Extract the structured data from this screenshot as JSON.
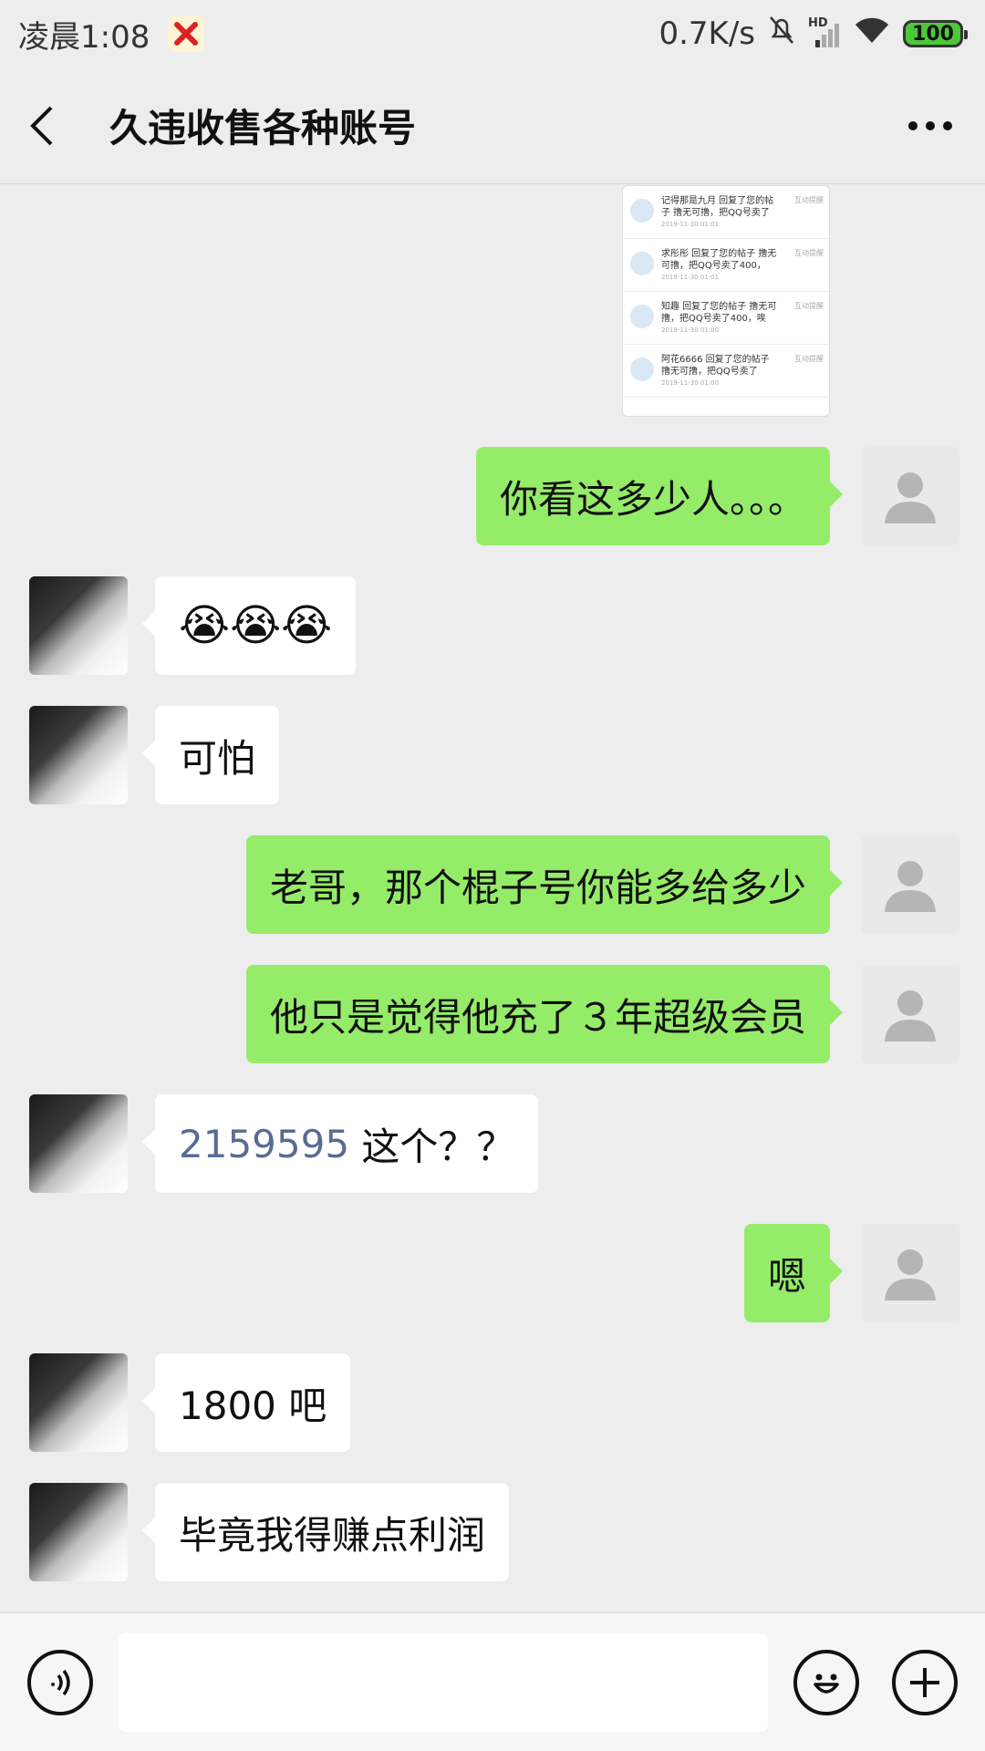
{
  "status_bar": {
    "time": "凌晨1:08",
    "network_speed": "0.7K/s",
    "hd_label": "HD",
    "battery": "100"
  },
  "header": {
    "title": "久违收售各种账号"
  },
  "shared_image": {
    "notifications": [
      {
        "text": "记得那是九月 回复了您的帖子 撸无可撸，把QQ号卖了",
        "time": "2019-11-30 01:01",
        "tag": "互动提醒"
      },
      {
        "text": "求彤彤 回复了您的帖子 撸无可撸，把QQ号卖了400，",
        "time": "2019-11-30 01:01",
        "tag": "互动提醒"
      },
      {
        "text": "知趣 回复了您的帖子 撸无可撸，把QQ号卖了400，唉",
        "time": "2019-11-30 01:00",
        "tag": "互动提醒"
      },
      {
        "text": "阿花6666 回复了您的帖子 撸无可撸，把QQ号卖了",
        "time": "2019-11-30 01:00",
        "tag": "互动提醒"
      }
    ]
  },
  "messages": [
    {
      "dir": "out",
      "text": "你看这多少人。。。"
    },
    {
      "dir": "in",
      "text": "😭😭😭"
    },
    {
      "dir": "in",
      "text": "可怕"
    },
    {
      "dir": "out",
      "text": "老哥，那个棍子号你能多给多少"
    },
    {
      "dir": "out",
      "text": "他只是觉得他充了３年超级会员"
    },
    {
      "dir": "in",
      "link": "2159595",
      "text": " 这个？？"
    },
    {
      "dir": "out",
      "text": "嗯"
    },
    {
      "dir": "in",
      "text": "1800 吧"
    },
    {
      "dir": "in",
      "text": "毕竟我得赚点利润"
    }
  ],
  "input_bar": {
    "placeholder": ""
  },
  "icons": {
    "back": "chevron-left-icon",
    "more": "more-dots-icon",
    "voice": "voice-icon",
    "emoji": "emoji-icon",
    "plus": "plus-icon"
  },
  "colors": {
    "background": "#ededed",
    "outgoing_bubble": "#95ec69",
    "incoming_bubble": "#ffffff",
    "link": "#576b95"
  }
}
